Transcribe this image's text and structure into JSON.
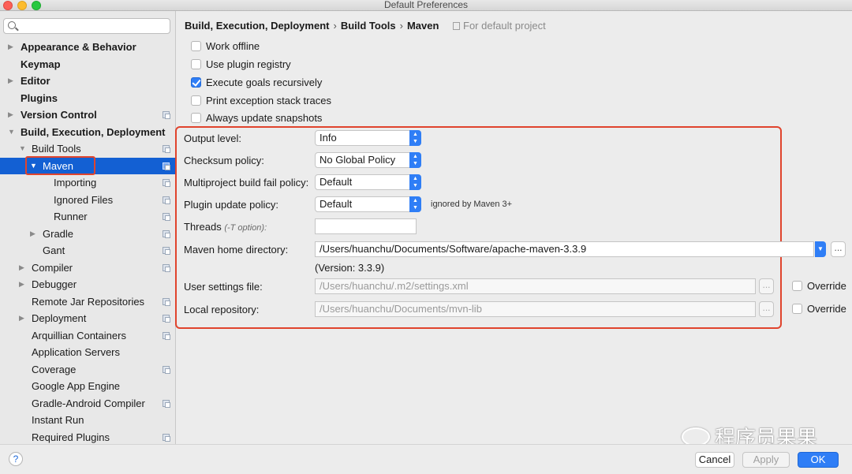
{
  "window": {
    "title": "Default Preferences"
  },
  "search": {
    "placeholder": ""
  },
  "sidebar": {
    "items": [
      {
        "label": "Appearance & Behavior",
        "bold": true,
        "arrow": "right",
        "indent": 0,
        "proj": false
      },
      {
        "label": "Keymap",
        "bold": true,
        "arrow": "",
        "indent": 0,
        "proj": false
      },
      {
        "label": "Editor",
        "bold": true,
        "arrow": "right",
        "indent": 0,
        "proj": false
      },
      {
        "label": "Plugins",
        "bold": true,
        "arrow": "",
        "indent": 0,
        "proj": false
      },
      {
        "label": "Version Control",
        "bold": true,
        "arrow": "right",
        "indent": 0,
        "proj": true
      },
      {
        "label": "Build, Execution, Deployment",
        "bold": true,
        "arrow": "down",
        "indent": 0,
        "proj": false
      },
      {
        "label": "Build Tools",
        "bold": false,
        "arrow": "down",
        "indent": 1,
        "proj": true
      },
      {
        "label": "Maven",
        "bold": false,
        "arrow": "down",
        "indent": 2,
        "proj": true,
        "selected": true
      },
      {
        "label": "Importing",
        "bold": false,
        "arrow": "",
        "indent": 3,
        "proj": true
      },
      {
        "label": "Ignored Files",
        "bold": false,
        "arrow": "",
        "indent": 3,
        "proj": true
      },
      {
        "label": "Runner",
        "bold": false,
        "arrow": "",
        "indent": 3,
        "proj": true
      },
      {
        "label": "Gradle",
        "bold": false,
        "arrow": "right",
        "indent": 2,
        "proj": true
      },
      {
        "label": "Gant",
        "bold": false,
        "arrow": "",
        "indent": 2,
        "proj": true
      },
      {
        "label": "Compiler",
        "bold": false,
        "arrow": "right",
        "indent": 1,
        "proj": true
      },
      {
        "label": "Debugger",
        "bold": false,
        "arrow": "right",
        "indent": 1,
        "proj": false
      },
      {
        "label": "Remote Jar Repositories",
        "bold": false,
        "arrow": "",
        "indent": 1,
        "proj": true
      },
      {
        "label": "Deployment",
        "bold": false,
        "arrow": "right",
        "indent": 1,
        "proj": true
      },
      {
        "label": "Arquillian Containers",
        "bold": false,
        "arrow": "",
        "indent": 1,
        "proj": true
      },
      {
        "label": "Application Servers",
        "bold": false,
        "arrow": "",
        "indent": 1,
        "proj": false
      },
      {
        "label": "Coverage",
        "bold": false,
        "arrow": "",
        "indent": 1,
        "proj": true
      },
      {
        "label": "Google App Engine",
        "bold": false,
        "arrow": "",
        "indent": 1,
        "proj": false
      },
      {
        "label": "Gradle-Android Compiler",
        "bold": false,
        "arrow": "",
        "indent": 1,
        "proj": true
      },
      {
        "label": "Instant Run",
        "bold": false,
        "arrow": "",
        "indent": 1,
        "proj": false
      },
      {
        "label": "Required Plugins",
        "bold": false,
        "arrow": "",
        "indent": 1,
        "proj": true
      }
    ]
  },
  "breadcrumb": {
    "part1": "Build, Execution, Deployment",
    "part2": "Build Tools",
    "part3": "Maven",
    "sep": "›"
  },
  "scope": {
    "label": "For default project"
  },
  "checkboxes": {
    "work_offline": {
      "label": "Work offline",
      "checked": false
    },
    "plugin_registry": {
      "label": "Use plugin registry",
      "checked": false
    },
    "execute_recursively": {
      "label": "Execute goals recursively",
      "checked": true
    },
    "print_traces": {
      "label": "Print exception stack traces",
      "checked": false
    },
    "update_snapshots": {
      "label": "Always update snapshots",
      "checked": false
    }
  },
  "settings": {
    "output_level": {
      "label": "Output level:",
      "value": "Info"
    },
    "checksum": {
      "label": "Checksum policy:",
      "value": "No Global Policy"
    },
    "fail_policy": {
      "label": "Multiproject build fail policy:",
      "value": "Default"
    },
    "plugin_update": {
      "label": "Plugin update policy:",
      "value": "Default",
      "note": "ignored by Maven 3+"
    },
    "threads": {
      "label": "Threads",
      "hint": "(-T option):",
      "value": ""
    },
    "home_dir": {
      "label": "Maven home directory:",
      "value": "/Users/huanchu/Documents/Software/apache-maven-3.3.9",
      "version": "(Version: 3.3.9)"
    },
    "user_settings": {
      "label": "User settings file:",
      "value": "/Users/huanchu/.m2/settings.xml",
      "override": "Override"
    },
    "local_repo": {
      "label": "Local repository:",
      "value": "/Users/huanchu/Documents/mvn-lib",
      "override": "Override"
    }
  },
  "ellipsis": "...",
  "buttons": {
    "help": "?",
    "cancel": "Cancel",
    "apply": "Apply",
    "ok": "OK"
  },
  "watermark": "程序员果果",
  "colors": {
    "accent": "#2f7ef6",
    "selection": "#1360d3",
    "highlight_box": "#e0442d"
  }
}
